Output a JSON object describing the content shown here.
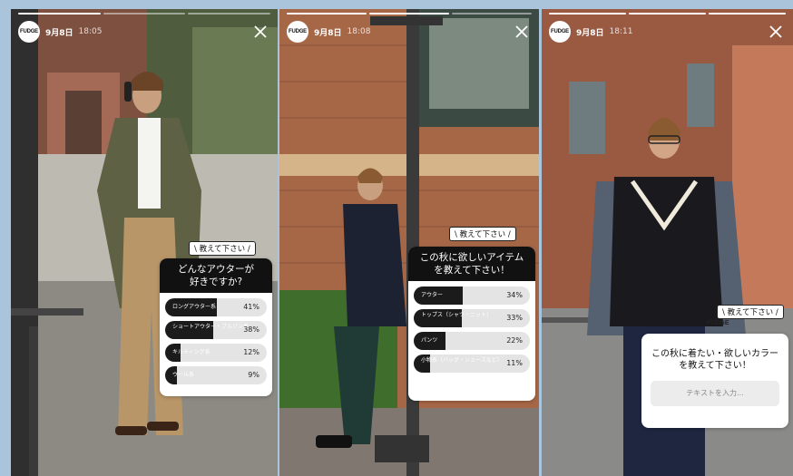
{
  "stories": [
    {
      "brand": "FUDGE",
      "date": "9月8日",
      "time": "18:05",
      "tag": "\\ 教えて下さい /",
      "question": "どんなアウターが\n好きですか?",
      "options": [
        {
          "label": "ロングアウター系",
          "percent": "41%",
          "value": 0.41
        },
        {
          "label": "ショートアウター・ブルゾン系",
          "percent": "38%",
          "value": 0.38
        },
        {
          "label": "キルティング系",
          "percent": "12%",
          "value": 0.12
        },
        {
          "label": "ウール系",
          "percent": "9%",
          "value": 0.09
        }
      ]
    },
    {
      "brand": "FUDGE",
      "date": "9月8日",
      "time": "18:08",
      "tag": "\\ 教えて下さい /",
      "question": "この秋に欲しいアイテム\nを教えて下さい！",
      "options": [
        {
          "label": "アウター",
          "percent": "34%",
          "value": 0.34
        },
        {
          "label": "トップス（シャツ・ニット）",
          "percent": "33%",
          "value": 0.33
        },
        {
          "label": "パンツ",
          "percent": "22%",
          "value": 0.22
        },
        {
          "label": "小物系（バッグ・シューズなど）",
          "percent": "11%",
          "value": 0.11
        }
      ]
    },
    {
      "brand": "FUDGE",
      "date": "9月8日",
      "time": "18:11",
      "tag": "\\ 教えて下さい /",
      "question": "この秋に着たい・欲しいカラー\nを教えて下さい！",
      "input_placeholder": "テキストを入力..."
    }
  ],
  "icons": {
    "close": "close-icon",
    "avatar": "fudge-avatar"
  }
}
